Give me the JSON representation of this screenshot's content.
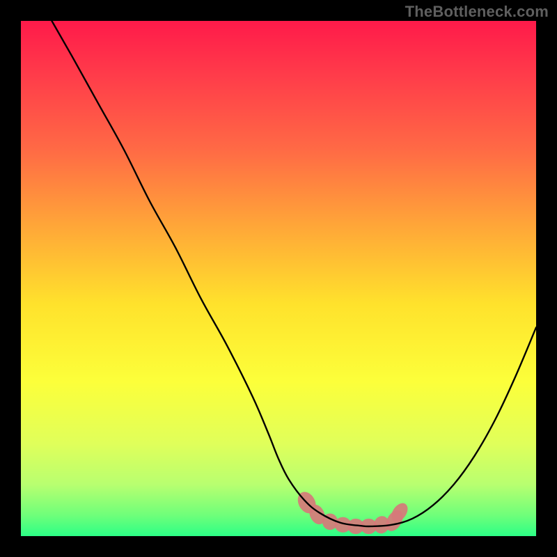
{
  "watermark": "TheBottleneck.com",
  "chart_data": {
    "type": "line",
    "title": "",
    "xlabel": "",
    "ylabel": "",
    "xlim": [
      0,
      100
    ],
    "ylim": [
      0,
      100
    ],
    "background_gradient": {
      "stops": [
        {
          "offset": 0.0,
          "color": "#ff1a4a"
        },
        {
          "offset": 0.1,
          "color": "#ff3a4a"
        },
        {
          "offset": 0.25,
          "color": "#ff6a45"
        },
        {
          "offset": 0.4,
          "color": "#ffa738"
        },
        {
          "offset": 0.55,
          "color": "#ffe22c"
        },
        {
          "offset": 0.7,
          "color": "#fcff3a"
        },
        {
          "offset": 0.82,
          "color": "#e0ff5a"
        },
        {
          "offset": 0.9,
          "color": "#b8ff70"
        },
        {
          "offset": 0.96,
          "color": "#6eff7a"
        },
        {
          "offset": 1.0,
          "color": "#2cff86"
        }
      ]
    },
    "series": [
      {
        "name": "bottleneck-curve",
        "color": "#000000",
        "x": [
          6,
          10,
          15,
          20,
          25,
          30,
          35,
          40,
          45,
          48,
          50,
          52,
          55,
          58,
          62,
          66,
          68,
          72,
          76,
          80,
          84,
          88,
          92,
          96,
          100
        ],
        "y": [
          100,
          93,
          84,
          75,
          65,
          56,
          46,
          37,
          27,
          20,
          15,
          11,
          7,
          4.5,
          2.6,
          2.0,
          1.9,
          2.2,
          3.4,
          6.0,
          10.0,
          15.5,
          22.5,
          31.0,
          40.5
        ]
      }
    ],
    "highlight": {
      "name": "optimal-region",
      "color": "#d67a7a",
      "x_range": [
        55,
        73
      ],
      "blobs": [
        {
          "cx": 55.5,
          "cy": 6.5,
          "rx": 1.6,
          "ry": 2.2,
          "rot": -28
        },
        {
          "cx": 57.5,
          "cy": 4.2,
          "rx": 1.4,
          "ry": 2.0,
          "rot": -24
        },
        {
          "cx": 60.0,
          "cy": 2.8,
          "rx": 1.5,
          "ry": 1.6,
          "rot": 0
        },
        {
          "cx": 62.5,
          "cy": 2.2,
          "rx": 1.6,
          "ry": 1.5,
          "rot": 0
        },
        {
          "cx": 65.0,
          "cy": 1.9,
          "rx": 1.6,
          "ry": 1.5,
          "rot": 0
        },
        {
          "cx": 67.5,
          "cy": 1.9,
          "rx": 1.6,
          "ry": 1.5,
          "rot": 0
        },
        {
          "cx": 70.0,
          "cy": 2.2,
          "rx": 1.5,
          "ry": 1.7,
          "rot": 12
        },
        {
          "cx": 72.5,
          "cy": 3.0,
          "rx": 1.4,
          "ry": 2.2,
          "rot": 30
        },
        {
          "cx": 73.5,
          "cy": 4.6,
          "rx": 1.3,
          "ry": 2.0,
          "rot": 35
        }
      ]
    }
  }
}
